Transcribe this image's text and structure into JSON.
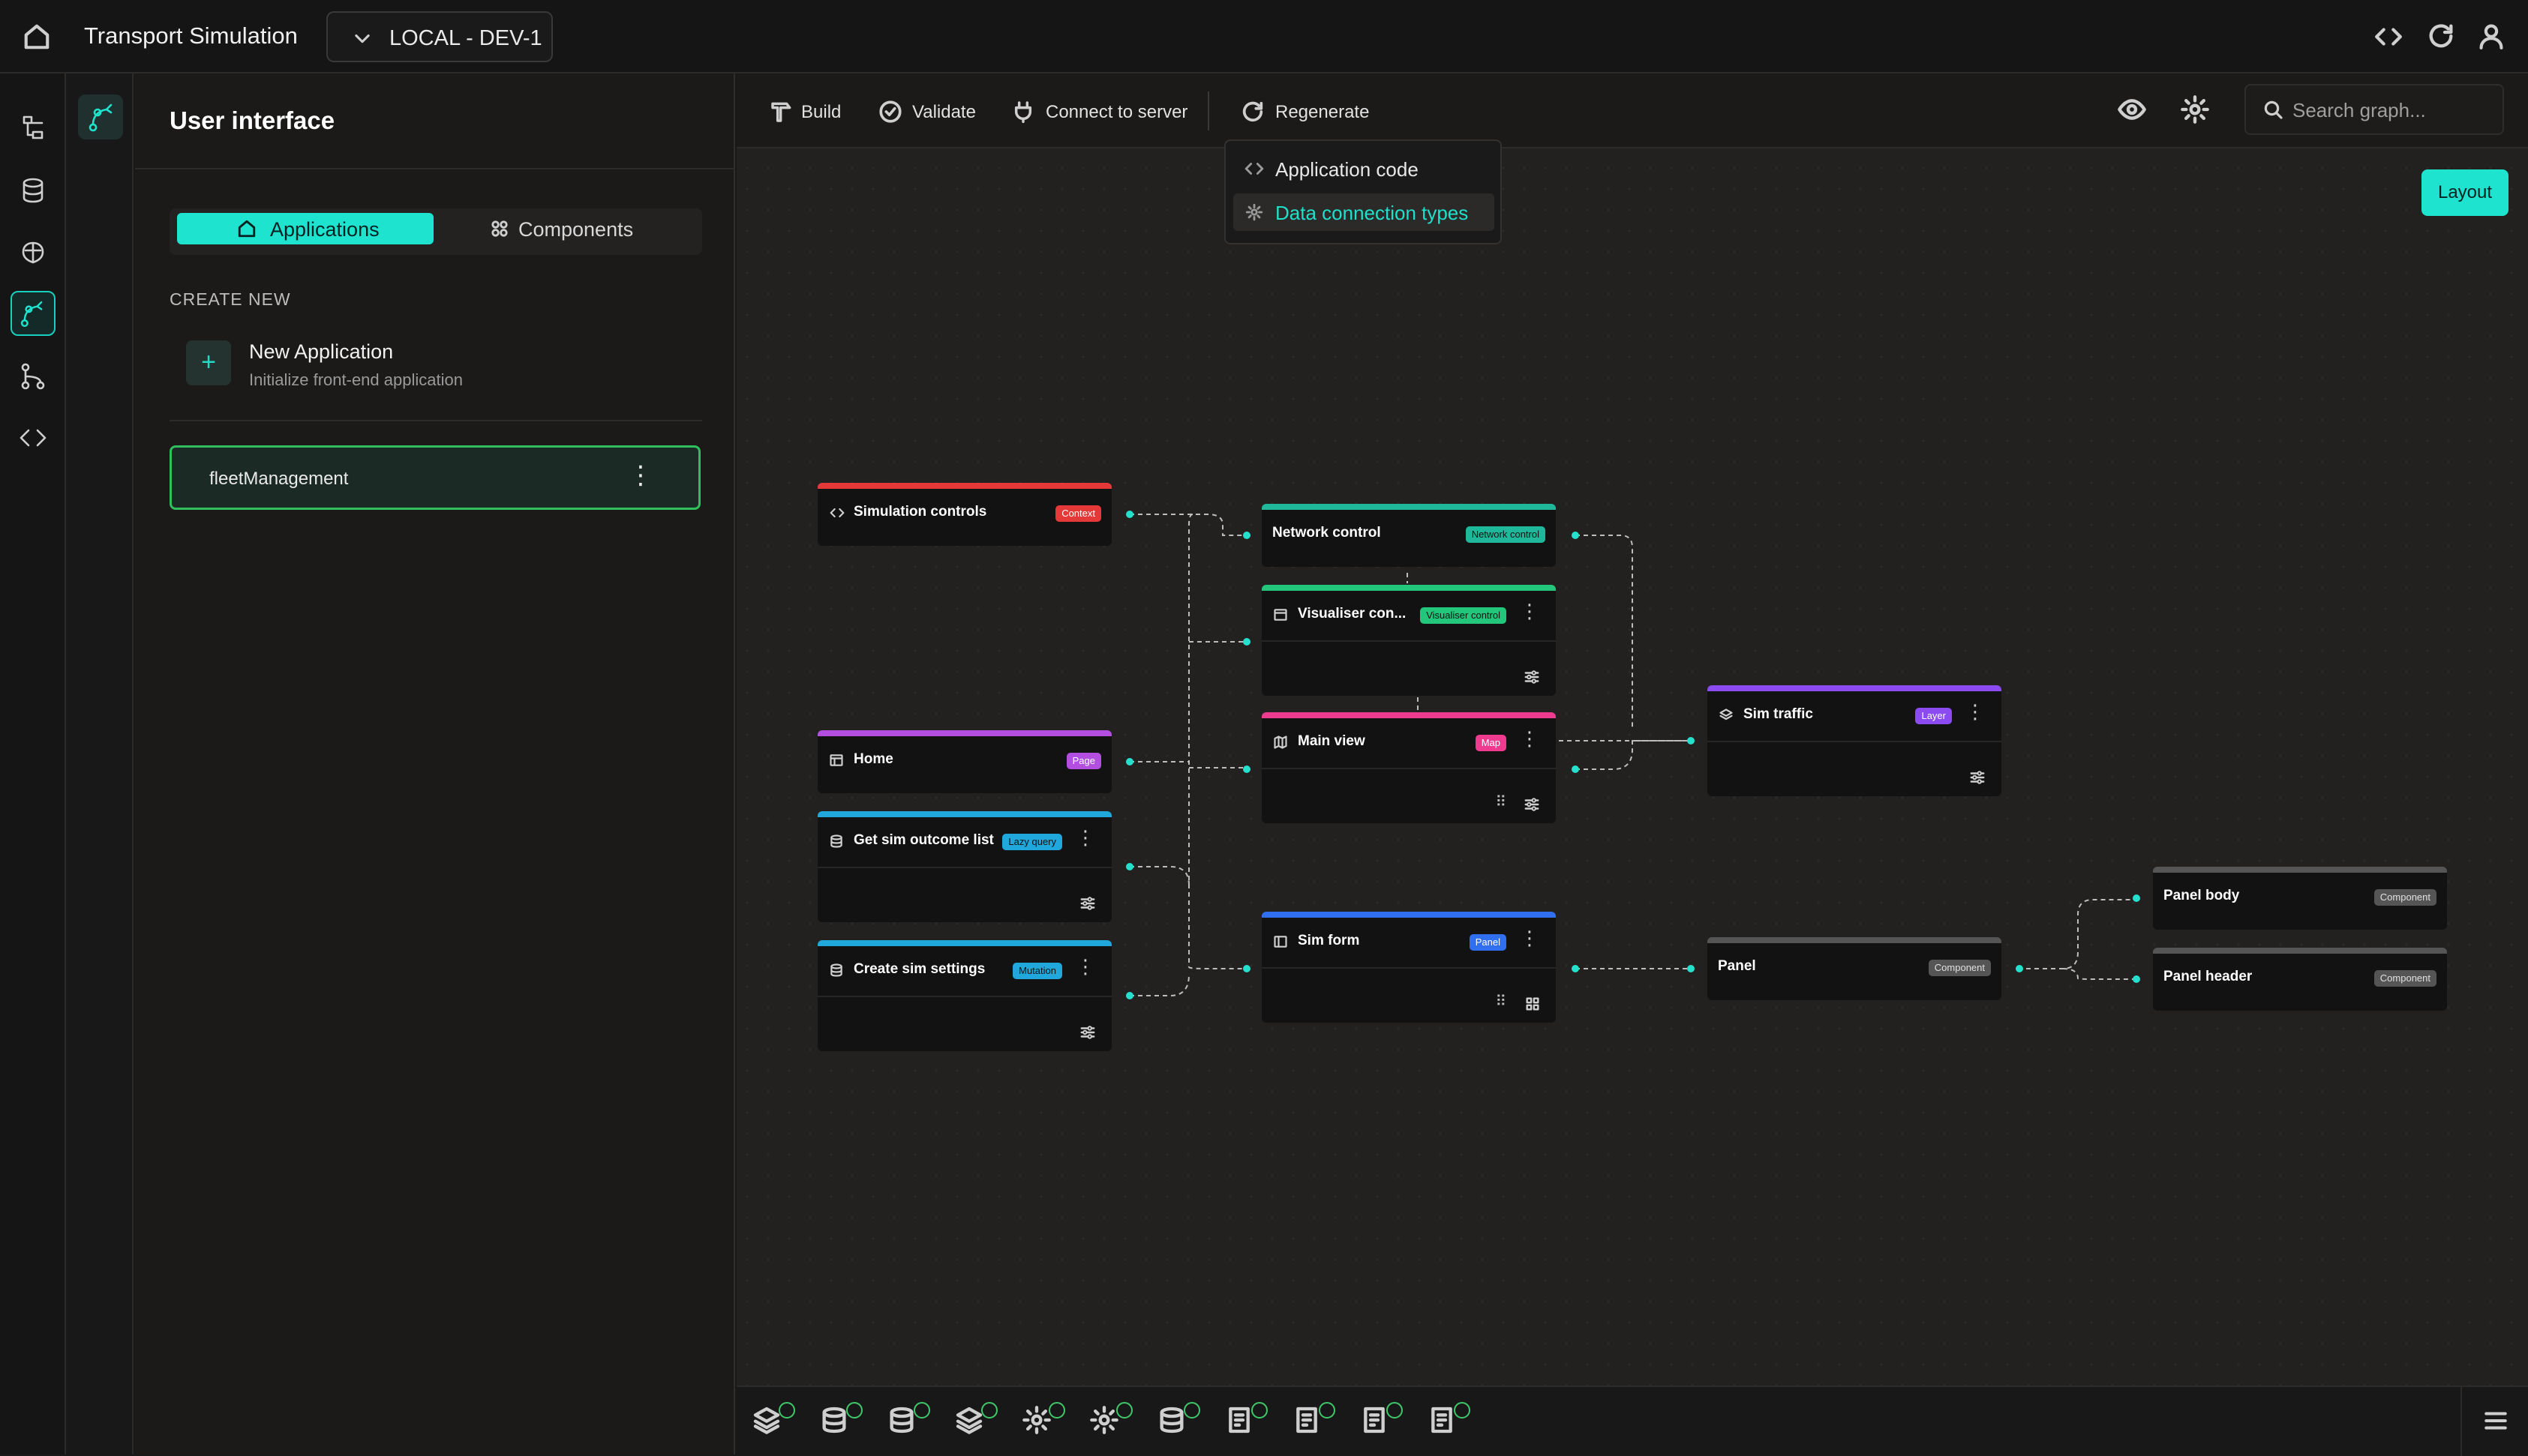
{
  "app": {
    "title": "Transport Simulation",
    "environment": "LOCAL - DEV-1"
  },
  "sidebar": {
    "title": "User interface",
    "tabs": [
      {
        "label": "Applications",
        "active": true
      },
      {
        "label": "Components",
        "active": false
      }
    ],
    "create_new_label": "CREATE NEW",
    "new_application": {
      "title": "New Application",
      "subtitle": "Initialize front-end application"
    },
    "applications": [
      {
        "name": "fleetManagement",
        "selected": true
      }
    ]
  },
  "toolbar": {
    "build": "Build",
    "validate": "Validate",
    "connect": "Connect to server",
    "regenerate": "Regenerate",
    "search_placeholder": "Search graph..."
  },
  "regenerate_menu": [
    {
      "label": "Application code",
      "icon": "code-icon"
    },
    {
      "label": "Data connection types",
      "icon": "gear-icon",
      "highlighted": true
    }
  ],
  "layout_button": "Layout",
  "nodes": [
    {
      "id": "sim-controls",
      "title": "Simulation controls",
      "badge": "Context",
      "color": "#e53838"
    },
    {
      "id": "network-control",
      "title": "Network control",
      "badge": "Network control",
      "color": "#1fb89a"
    },
    {
      "id": "visualiser",
      "title": "Visualiser con...",
      "badge": "Visualiser control",
      "color": "#22c77b"
    },
    {
      "id": "main-view",
      "title": "Main view",
      "badge": "Map",
      "color": "#ee3a8f"
    },
    {
      "id": "home",
      "title": "Home",
      "badge": "Page",
      "color": "#b34fe0"
    },
    {
      "id": "get-sim",
      "title": "Get sim outcome list",
      "badge": "Lazy query",
      "color": "#20a8dc"
    },
    {
      "id": "create-sim",
      "title": "Create sim settings",
      "badge": "Mutation",
      "color": "#20a8dc"
    },
    {
      "id": "sim-form",
      "title": "Sim form",
      "badge": "Panel",
      "color": "#2f6ff0"
    },
    {
      "id": "sim-traffic",
      "title": "Sim traffic",
      "badge": "Layer",
      "color": "#8b4bf0"
    },
    {
      "id": "panel",
      "title": "Panel",
      "badge": "Component",
      "color": "#555555"
    },
    {
      "id": "panel-body",
      "title": "Panel body",
      "badge": "Component",
      "color": "#555555"
    },
    {
      "id": "panel-header",
      "title": "Panel header",
      "badge": "Component",
      "color": "#555555"
    }
  ],
  "colors": {
    "accent": "#1ee3cf",
    "selected_border": "#2fbf5c",
    "check": "#3fc86a"
  },
  "bottom_bar_icons": [
    "layers-icon",
    "database-icon",
    "database-icon",
    "layers-icon",
    "gear-icon",
    "gear-icon",
    "database-icon",
    "document-icon",
    "document-icon",
    "document-icon",
    "document-icon"
  ]
}
